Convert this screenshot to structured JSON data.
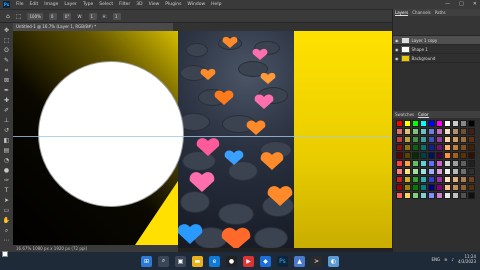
{
  "app": {
    "name": "Ps",
    "menus": [
      "File",
      "Edit",
      "Image",
      "Layer",
      "Type",
      "Select",
      "Filter",
      "3D",
      "View",
      "Plugins",
      "Window",
      "Help"
    ],
    "window_controls": [
      "—",
      "□",
      "✕"
    ]
  },
  "options": {
    "tool_value": "100%",
    "size_value": "0",
    "angle_value": "0°",
    "label_a": "W:",
    "label_b": "H:",
    "field_a": "1",
    "field_b": "1"
  },
  "document": {
    "tab": "Untitled-1 @ 16.7% (Layer 1, RGB/8#) *",
    "status": "16.67%   1080 px x 1920 px (72 ppi)"
  },
  "layers_panel": {
    "tabs": [
      "Layers",
      "Channels",
      "Paths"
    ],
    "rows": [
      {
        "name": "Layer 1 copy",
        "icon": "eye-icon"
      },
      {
        "name": "Shape 1",
        "icon": "eye-icon"
      },
      {
        "name": "Background",
        "icon": "eye-icon"
      }
    ]
  },
  "swatches_panel": {
    "tabs": [
      "Swatches",
      "Color"
    ]
  },
  "taskbar": {
    "time": "11:24",
    "date": "4/3/2023",
    "lang": "ENG"
  }
}
